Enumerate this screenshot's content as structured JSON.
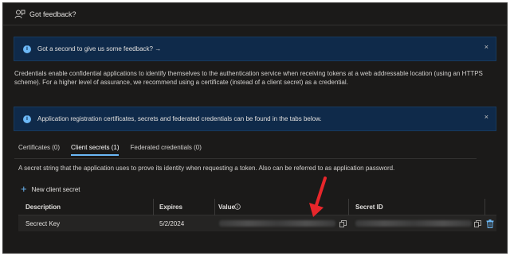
{
  "toolbar": {
    "feedback_label": "Got feedback?"
  },
  "banner_feedback": {
    "text": "Got a second to give us some feedback? →",
    "close": "×"
  },
  "description": "Credentials enable confidential applications to identify themselves to the authentication service when receiving tokens at a web addressable location (using an HTTPS scheme). For a higher level of assurance, we recommend using a certificate (instead of a client secret) as a credential.",
  "banner_info": {
    "text": "Application registration certificates, secrets and federated credentials can be found in the tabs below.",
    "close": "×"
  },
  "tabs": [
    {
      "label": "Certificates (0)"
    },
    {
      "label": "Client secrets (1)"
    },
    {
      "label": "Federated credentials (0)"
    }
  ],
  "secret_description": "A secret string that the application uses to prove its identity when requesting a token. Also can be referred to as application password.",
  "new_secret_label": "New client secret",
  "table": {
    "headers": {
      "description": "Description",
      "expires": "Expires",
      "value": "Value",
      "secret_id": "Secret ID"
    },
    "rows": [
      {
        "description": "Secrect Key",
        "expires": "5/2/2024",
        "value_masked": true,
        "secret_id_masked": true
      }
    ]
  },
  "colors": {
    "accent": "#6cb8f6",
    "annotation_arrow": "#e8262b",
    "banner_bg": "#0f2a4a"
  }
}
